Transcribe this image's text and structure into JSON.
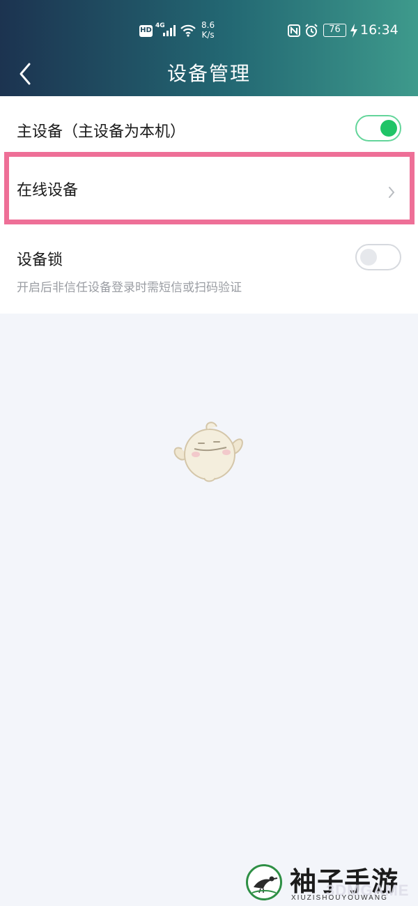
{
  "status_bar": {
    "hd": "HD",
    "network": "4G",
    "speed_value": "8.6",
    "speed_unit": "K/s",
    "battery": "76",
    "time": "16:34"
  },
  "nav": {
    "title": "设备管理",
    "back_icon": "chevron-left-icon"
  },
  "settings": {
    "primary_device": {
      "label": "主设备（主设备为本机）",
      "enabled": true
    },
    "online_devices": {
      "label": "在线设备",
      "icon": "chevron-right-icon"
    },
    "device_lock": {
      "label": "设备锁",
      "description": "开启后非信任设备登录时需短信或扫码验证",
      "enabled": false
    }
  },
  "watermark": {
    "title": "袖子手游网",
    "subtitle": "XIUZISHOUYOUWANG",
    "overlay": "3DMGAME"
  },
  "colors": {
    "header_start": "#1c3350",
    "header_end": "#3e9a8c",
    "toggle_on": "#20c467",
    "highlight_border": "#ee6f97",
    "background": "#f3f5fa"
  }
}
